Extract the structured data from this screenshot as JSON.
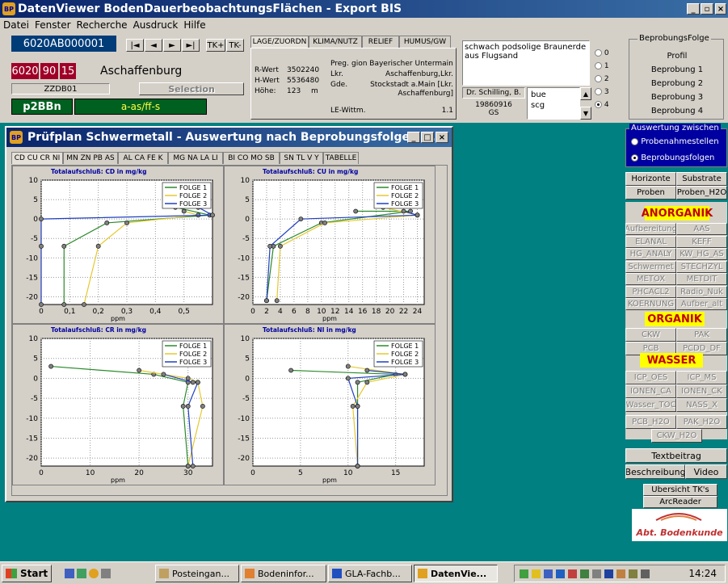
{
  "app": {
    "title": "DatenViewer BodenDauerbeobachtungsFlächen - Export BIS",
    "menu": [
      "Datei",
      "Fenster",
      "Recherche",
      "Ausdruck",
      "Hilfe"
    ],
    "window_controls": {
      "minimize": "_",
      "restore": "▫",
      "close": "×"
    }
  },
  "site": {
    "id": "6020AB000001",
    "num_a": "6020",
    "num_b": "90",
    "num_c": "15",
    "name": "Aschaffenburg",
    "code": "ZZDB01",
    "selection_label": "Selection",
    "green_left": "p2BBn",
    "green_right": "a-as/ff-s"
  },
  "nav_buttons": [
    "|◄",
    "◄",
    "►",
    "►|",
    "TK+",
    "TK-"
  ],
  "top_tabs": [
    "LAGE/ZUORDN",
    "KLIMA/NUTZ",
    "RELIEF",
    "HUMUS/GW"
  ],
  "lage": {
    "rwert_label": "R-Wert",
    "rwert": "3502240",
    "hwert_label": "H-Wert",
    "hwert": "5536480",
    "hoehe_label": "Höhe:",
    "hoehe": "123",
    "hoehe_unit": "m",
    "preg_label": "Preg.",
    "preg": "gion Bayerischer Untermain",
    "lkr_label": "Lkr.",
    "lkr": "Aschaffenburg,Lkr.",
    "gde_label": "Gde.",
    "gde1": "Stockstadt a.Main [Lkr.",
    "gde2": "Aschaffenburg]",
    "lewittm_label": "LE-Wittm.",
    "lewittm": "1.1"
  },
  "soil_text": "schwach podsolige Braunerde aus Flugsand",
  "person": {
    "name": "Dr. Schilling, B.",
    "date": "19860916",
    "code": "GS"
  },
  "small_list": [
    "bue",
    "scg"
  ],
  "beprobung": {
    "title": "BeprobungsFolge",
    "radios": [
      "0",
      "1",
      "2",
      "3",
      "4"
    ],
    "selected": "4",
    "labels": [
      "Profil",
      "Beprobung 1",
      "Beprobung 2",
      "Beprobung 3",
      "Beprobung 4"
    ]
  },
  "child_window": {
    "title": "Prüfplan Schwermetall - Auswertung nach Beprobungsfolgen (...",
    "tabs": [
      "CD CU CR NI",
      "MN ZN PB AS",
      "AL CA FE K",
      "MG NA LA LI",
      "BI CO MO SB",
      "SN TL V Y",
      "TABELLE"
    ]
  },
  "chart_data": [
    {
      "type": "line",
      "title": "Totalaufschluß: CD in mg/kg",
      "xlabel": "ppm",
      "xlim": [
        0,
        0.6
      ],
      "xticks": [
        "0",
        "0,1",
        "0,2",
        "0,3",
        "0,4",
        "0,5"
      ],
      "xtick_values": [
        0,
        0.1,
        0.2,
        0.3,
        0.4,
        0.5
      ],
      "ylim": [
        -22,
        10
      ],
      "yticks": [
        10,
        5,
        0,
        -5,
        -10,
        -15,
        -20
      ],
      "legend": "top-right",
      "series": [
        {
          "name": "FOLGE 1",
          "color": "#2a8a2a",
          "points": [
            [
              0.47,
              3
            ],
            [
              0.59,
              1
            ],
            [
              0.23,
              -1
            ],
            [
              0.08,
              -7
            ],
            [
              0.08,
              -22
            ]
          ]
        },
        {
          "name": "FOLGE 2",
          "color": "#e6c830",
          "points": [
            [
              0.5,
              2
            ],
            [
              0.55,
              1
            ],
            [
              0.3,
              -1
            ],
            [
              0.2,
              -7
            ],
            [
              0.15,
              -22
            ]
          ]
        },
        {
          "name": "FOLGE 3",
          "color": "#2040c0",
          "points": [
            [
              0.55,
              3
            ],
            [
              0.6,
              1
            ],
            [
              0.0,
              0
            ],
            [
              0.0,
              -7
            ],
            [
              0.0,
              -22
            ]
          ]
        }
      ]
    },
    {
      "type": "line",
      "title": "Totalaufschluß: CU in mg/kg",
      "xlabel": "ppm",
      "xlim": [
        0,
        25
      ],
      "xticks": [
        "0",
        "2",
        "4",
        "6",
        "8",
        "10",
        "12",
        "14",
        "16",
        "18",
        "20",
        "22",
        "24"
      ],
      "xtick_values": [
        0,
        2,
        4,
        6,
        8,
        10,
        12,
        14,
        16,
        18,
        20,
        22,
        24
      ],
      "ylim": [
        -22,
        10
      ],
      "yticks": [
        10,
        5,
        0,
        -5,
        -10,
        -15,
        -20
      ],
      "legend": "top-right",
      "series": [
        {
          "name": "FOLGE 1",
          "color": "#2a8a2a",
          "points": [
            [
              15,
              2
            ],
            [
              23,
              2
            ],
            [
              10,
              -1
            ],
            [
              3,
              -7
            ],
            [
              2,
              -21
            ]
          ]
        },
        {
          "name": "FOLGE 2",
          "color": "#e6c830",
          "points": [
            [
              19,
              3
            ],
            [
              24,
              1
            ],
            [
              10.5,
              -1
            ],
            [
              4,
              -7
            ],
            [
              3.5,
              -21
            ]
          ]
        },
        {
          "name": "FOLGE 3",
          "color": "#2040c0",
          "points": [
            [
              22,
              2
            ],
            [
              24,
              1
            ],
            [
              7,
              0
            ],
            [
              2.5,
              -7
            ],
            [
              2,
              -21
            ]
          ]
        }
      ]
    },
    {
      "type": "line",
      "title": "Totalaufschluß: CR in mg/kg",
      "xlabel": "ppm",
      "xlim": [
        0,
        35
      ],
      "xticks": [
        "0",
        "10",
        "20",
        "30"
      ],
      "xtick_values": [
        0,
        10,
        20,
        30
      ],
      "ylim": [
        -22,
        10
      ],
      "yticks": [
        10,
        5,
        0,
        -5,
        -10,
        -15,
        -20
      ],
      "legend": "top-right",
      "series": [
        {
          "name": "FOLGE 1",
          "color": "#2a8a2a",
          "points": [
            [
              2,
              3
            ],
            [
              23,
              1
            ],
            [
              30,
              -1
            ],
            [
              29,
              -7
            ],
            [
              30,
              -22
            ]
          ]
        },
        {
          "name": "FOLGE 2",
          "color": "#e6c830",
          "points": [
            [
              20,
              2
            ],
            [
              30,
              0
            ],
            [
              32,
              -1
            ],
            [
              33,
              -7
            ],
            [
              30,
              -22
            ]
          ]
        },
        {
          "name": "FOLGE 3",
          "color": "#2040c0",
          "points": [
            [
              25,
              1
            ],
            [
              31,
              -1
            ],
            [
              32,
              -1
            ],
            [
              30,
              -7
            ],
            [
              31,
              -22
            ]
          ]
        }
      ]
    },
    {
      "type": "line",
      "title": "Totalaufschluß: NI in mg/kg",
      "xlabel": "ppm",
      "xlim": [
        0,
        18
      ],
      "xticks": [
        "0",
        "5",
        "10",
        "15"
      ],
      "xtick_values": [
        0,
        5,
        10,
        15
      ],
      "ylim": [
        -22,
        10
      ],
      "yticks": [
        10,
        5,
        0,
        -5,
        -10,
        -15,
        -20
      ],
      "legend": "top-right",
      "series": [
        {
          "name": "FOLGE 1",
          "color": "#2a8a2a",
          "points": [
            [
              4,
              2
            ],
            [
              15,
              1
            ],
            [
              11,
              -1
            ],
            [
              11,
              -7
            ],
            [
              11,
              -22
            ]
          ]
        },
        {
          "name": "FOLGE 2",
          "color": "#e6c830",
          "points": [
            [
              10,
              3
            ],
            [
              16,
              1
            ],
            [
              12,
              -1
            ],
            [
              10.5,
              -7
            ],
            [
              11,
              -22
            ]
          ]
        },
        {
          "name": "FOLGE 3",
          "color": "#2040c0",
          "points": [
            [
              12,
              2
            ],
            [
              16,
              1
            ],
            [
              10,
              0
            ],
            [
              11,
              -7
            ],
            [
              11,
              -22
            ]
          ]
        }
      ]
    }
  ],
  "right_panel": {
    "group_title": "Auswertung zwischen",
    "radio1": "Probenahmestellen",
    "radio2": "Beprobungsfolgen",
    "buttons1": [
      "Horizonte",
      "Substrate",
      "Proben",
      "Proben_H2O"
    ],
    "anorganik": "ANORGANIK",
    "anorg_buttons": [
      "Aufbereitung",
      "AAS",
      "ELANAL",
      "KEFF",
      "HG_ANALY",
      "KW_HG_AS",
      "Schwermet",
      "STECHZYL",
      "METOX",
      "METDIT",
      "PHCACL2",
      "Radio_Nuk",
      "KOERNUNG",
      "Aufber_alt"
    ],
    "organik": "ORGANIK",
    "org_buttons": [
      "CKW",
      "PAK",
      "PCB",
      "PCDD_DF"
    ],
    "wasser": "WASSER",
    "wasser_buttons": [
      "ICP_OES",
      "ICP_MS",
      "IONEN_CA",
      "IONEN_CK",
      "Wasser_TOC",
      "NASS_X",
      "PCB_H2O",
      "PAK_H2O",
      "CKW_H2O"
    ],
    "textbeitrag": "Textbeitrag",
    "beschreibung": "Beschreibung",
    "video": "Video",
    "uebersicht": "Ubersicht TK's",
    "arcreader": "ArcReader",
    "logo": "Abt. Bodenkunde"
  },
  "taskbar": {
    "start": "Start",
    "items": [
      "Posteingan...",
      "Bodeninfor...",
      "GLA-Fachb...",
      "DatenVie..."
    ],
    "clock": "14:24"
  }
}
